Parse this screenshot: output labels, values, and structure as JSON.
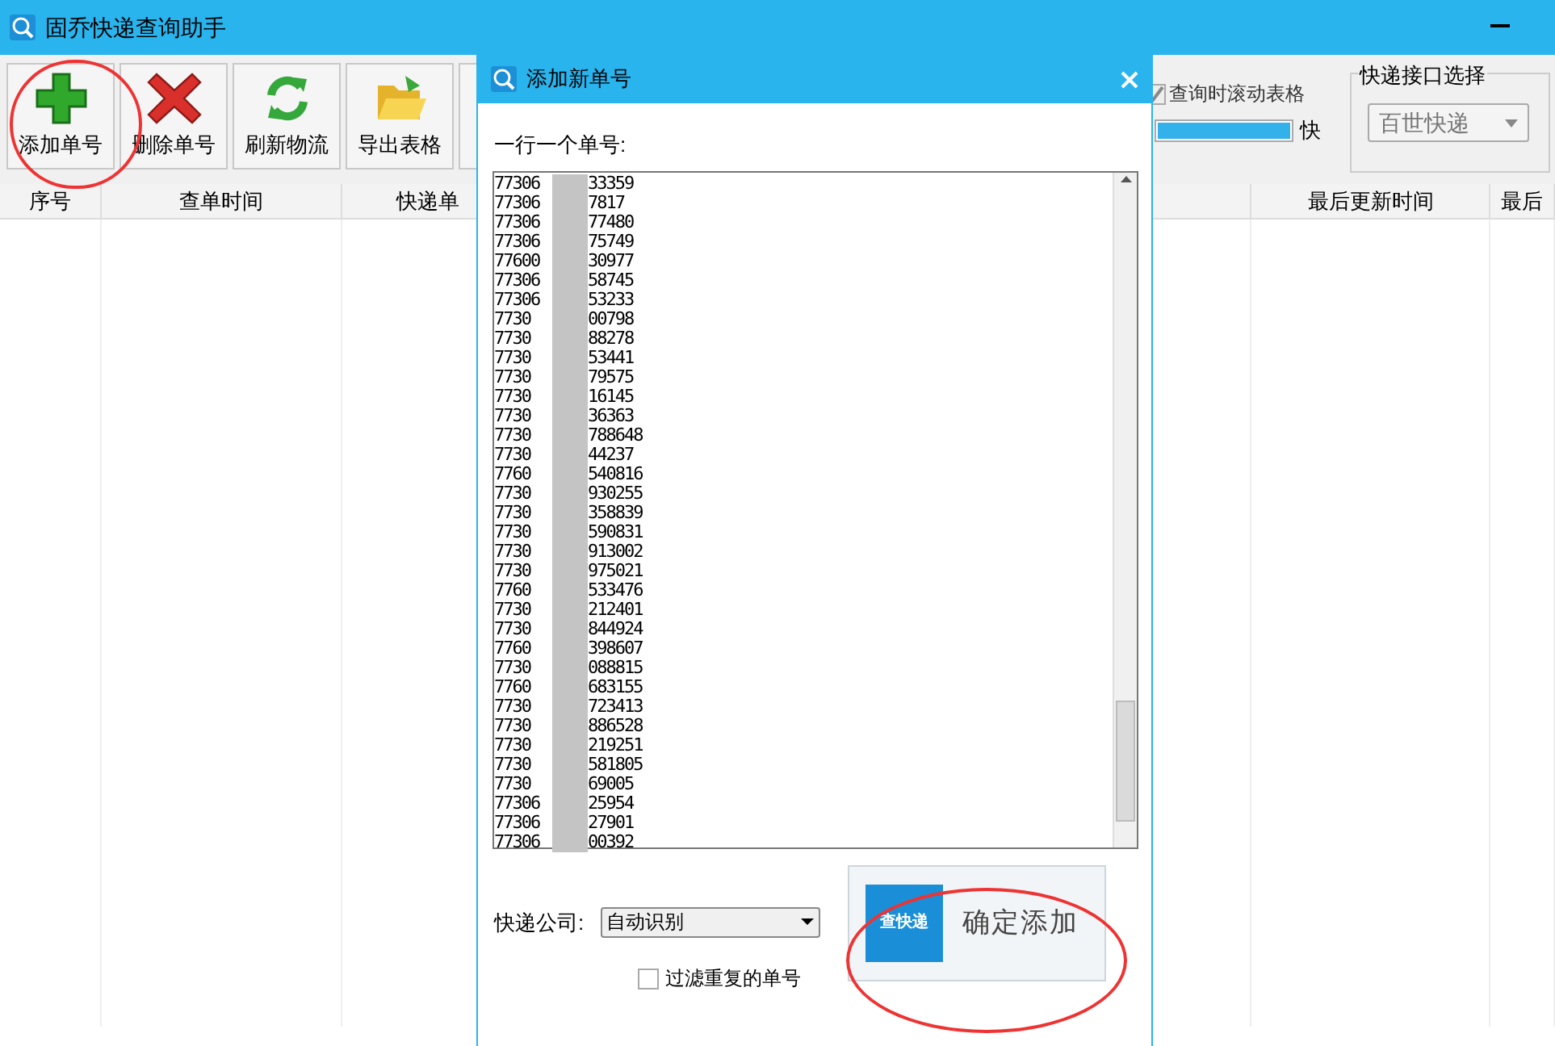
{
  "window": {
    "title": "固乔快递查询助手"
  },
  "toolbar": [
    {
      "label": "添加单号",
      "kind": "add"
    },
    {
      "label": "删除单号",
      "kind": "delete"
    },
    {
      "label": "刷新物流",
      "kind": "refresh"
    },
    {
      "label": "导出表格",
      "kind": "export"
    }
  ],
  "options": {
    "scroll_checkbox": {
      "label": "查询时滚动表格",
      "checked": true
    },
    "speed": {
      "level": 1,
      "label": "快"
    }
  },
  "api_group": {
    "title": "快递接口选择",
    "value": "百世快递"
  },
  "table": {
    "columns": [
      {
        "label": "序号"
      },
      {
        "label": "查单时间"
      },
      {
        "label": "快递单"
      },
      {
        "label": "最后更新时间"
      },
      {
        "label": "最后"
      }
    ]
  },
  "dialog": {
    "title": "添加新单号",
    "prompt": "一行一个单号:",
    "lines": [
      {
        "start": "77306",
        "end": "33359"
      },
      {
        "start": "77306",
        "end": "7817"
      },
      {
        "start": "77306",
        "end": "77480"
      },
      {
        "start": "77306",
        "end": "75749"
      },
      {
        "start": "77600",
        "end": "30977"
      },
      {
        "start": "77306",
        "end": "58745"
      },
      {
        "start": "77306",
        "end": "53233"
      },
      {
        "start": "7730",
        "end": "00798"
      },
      {
        "start": "7730",
        "end": "88278"
      },
      {
        "start": "7730",
        "end": "53441"
      },
      {
        "start": "7730",
        "end": "79575"
      },
      {
        "start": "7730",
        "end": "16145"
      },
      {
        "start": "7730",
        "end": "36363"
      },
      {
        "start": "7730",
        "end": "788648"
      },
      {
        "start": "7730",
        "end": "44237"
      },
      {
        "start": "7760",
        "end": "540816"
      },
      {
        "start": "7730",
        "end": "930255"
      },
      {
        "start": "7730",
        "end": "358839"
      },
      {
        "start": "7730",
        "end": "590831"
      },
      {
        "start": "7730",
        "end": "913002"
      },
      {
        "start": "7730",
        "end": "975021"
      },
      {
        "start": "7760",
        "end": "533476"
      },
      {
        "start": "7730",
        "end": "212401"
      },
      {
        "start": "7730",
        "end": "844924"
      },
      {
        "start": "7760",
        "end": "398607"
      },
      {
        "start": "7730",
        "end": "088815"
      },
      {
        "start": "7760",
        "end": "683155"
      },
      {
        "start": "7730",
        "end": "723413"
      },
      {
        "start": "7730",
        "end": "886528"
      },
      {
        "start": "7730",
        "end": "219251"
      },
      {
        "start": "7730",
        "end": "581805"
      },
      {
        "start": "7730",
        "end": "69005"
      },
      {
        "start": "77306",
        "end": "25954"
      },
      {
        "start": "77306",
        "end": "27901"
      },
      {
        "start": "77306",
        "end": "00392"
      }
    ],
    "company_label": "快递公司:",
    "company_value": "自动识别",
    "filter_checkbox": {
      "label": "过滤重复的单号",
      "checked": false
    },
    "confirm_logo": "查快递",
    "confirm_label": "确定添加"
  }
}
